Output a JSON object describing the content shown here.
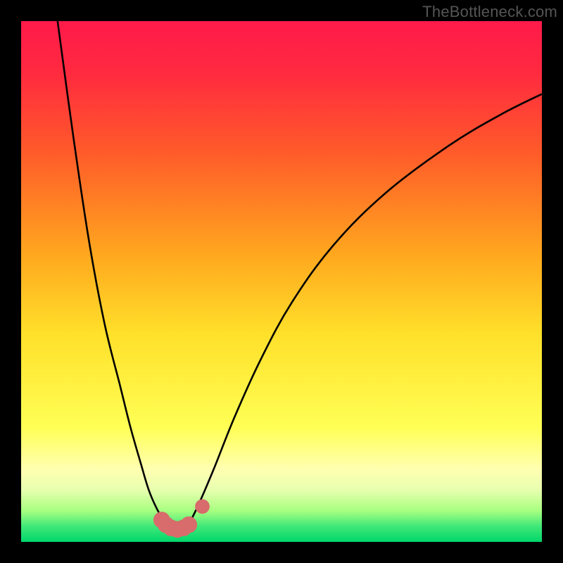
{
  "attribution": "TheBottleneck.com",
  "colors": {
    "frame": "#000000",
    "attribution_text": "#555555",
    "curve_stroke": "#000000",
    "marker_fill": "#d86b6b",
    "gradient_stops": [
      {
        "offset": 0.0,
        "color": "#ff1a4a"
      },
      {
        "offset": 0.1,
        "color": "#ff2a3f"
      },
      {
        "offset": 0.25,
        "color": "#ff5a2a"
      },
      {
        "offset": 0.45,
        "color": "#ffa81e"
      },
      {
        "offset": 0.6,
        "color": "#ffe02a"
      },
      {
        "offset": 0.78,
        "color": "#ffff55"
      },
      {
        "offset": 0.86,
        "color": "#ffffb0"
      },
      {
        "offset": 0.9,
        "color": "#e8ffb0"
      },
      {
        "offset": 0.94,
        "color": "#a8ff80"
      },
      {
        "offset": 0.97,
        "color": "#40e878"
      },
      {
        "offset": 1.0,
        "color": "#00d66a"
      }
    ]
  },
  "chart_data": {
    "type": "line",
    "title": "",
    "xlabel": "",
    "ylabel": "",
    "xlim": [
      0,
      100
    ],
    "ylim": [
      0,
      100
    ],
    "series": [
      {
        "name": "left-curve",
        "x": [
          7,
          10,
          13,
          16,
          19,
          21,
          23,
          24.5,
          26,
          27.5,
          29
        ],
        "values": [
          100,
          78,
          58,
          42,
          30,
          22,
          15,
          10,
          6.5,
          4,
          3
        ]
      },
      {
        "name": "right-curve",
        "x": [
          32,
          34,
          37,
          41,
          46,
          52,
          60,
          70,
          82,
          92,
          100
        ],
        "values": [
          3,
          7,
          14,
          24,
          35,
          46,
          57,
          67,
          76,
          82,
          86
        ]
      }
    ],
    "markers": [
      {
        "x": 27.0,
        "y": 4.2,
        "r": 1.6
      },
      {
        "x": 27.8,
        "y": 3.3,
        "r": 1.6
      },
      {
        "x": 28.8,
        "y": 2.7,
        "r": 1.6
      },
      {
        "x": 30.0,
        "y": 2.4,
        "r": 1.6
      },
      {
        "x": 31.2,
        "y": 2.7,
        "r": 1.6
      },
      {
        "x": 32.2,
        "y": 3.3,
        "r": 1.6
      },
      {
        "x": 34.8,
        "y": 6.8,
        "r": 1.4
      }
    ]
  }
}
